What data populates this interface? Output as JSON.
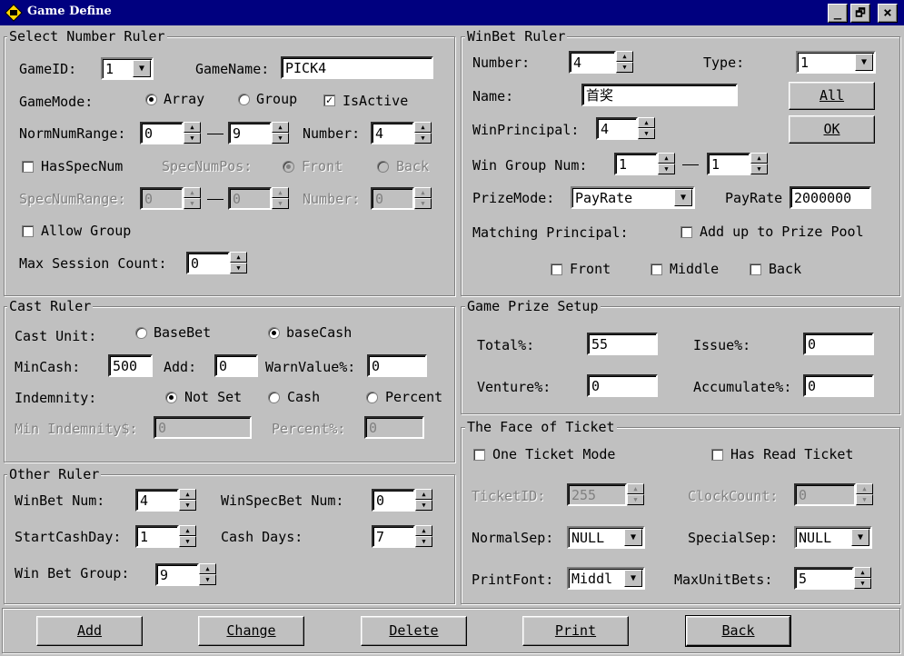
{
  "window": {
    "title": "Game Define",
    "min": "_",
    "max": "🗗",
    "close": "×"
  },
  "select": {
    "title": "Select Number Ruler",
    "gameid_label": "GameID:",
    "gameid_value": "1",
    "gamename_label": "GameName:",
    "gamename_value": "PICK4",
    "gamemode_label": "GameMode:",
    "array": "Array",
    "group": "Group",
    "isactive": "IsActive",
    "normrange_label": "NormNumRange:",
    "norm_from": "0",
    "norm_to": "9",
    "number_label": "Number:",
    "number_value": "4",
    "hasspec": "HasSpecNum",
    "specpos_label": "SpecNumPos:",
    "front": "Front",
    "back": "Back",
    "specrange_label": "SpecNumRange:",
    "spec_from": "0",
    "spec_to": "0",
    "spec_number_label": "Number:",
    "spec_number_value": "0",
    "allow_group": "Allow Group",
    "max_session_label": "Max Session Count:",
    "max_session_value": "0"
  },
  "cast": {
    "title": "Cast Ruler",
    "unit_label": "Cast Unit:",
    "basebet": "BaseBet",
    "basecash": "baseCash",
    "mincash_label": "MinCash:",
    "mincash_value": "500",
    "add_label": "Add:",
    "add_value": "0",
    "warn_label": "WarnValue%:",
    "warn_value": "0",
    "indemnity_label": "Indemnity:",
    "notset": "Not Set",
    "cash": "Cash",
    "percent": "Percent",
    "minind_label": "Min Indemnity$:",
    "minind_value": "0",
    "percent_label": "Percent%:",
    "percent_value": "0"
  },
  "other": {
    "title": "Other Ruler",
    "winbet_label": "WinBet Num:",
    "winbet_value": "4",
    "winspec_label": "WinSpecBet Num:",
    "winspec_value": "0",
    "startday_label": "StartCashDay:",
    "startday_value": "1",
    "cashdays_label": "Cash Days:",
    "cashdays_value": "7",
    "wingroup_label": "Win Bet Group:",
    "wingroup_value": "9"
  },
  "winbet": {
    "title": "WinBet Ruler",
    "number_label": "Number:",
    "number_value": "4",
    "type_label": "Type:",
    "type_value": "1",
    "name_label": "Name:",
    "name_value": "首奖",
    "all_btn": "All",
    "ok_btn": "OK",
    "principal_label": "WinPrincipal:",
    "principal_value": "4",
    "groupnum_label": "Win Group Num:",
    "group_from": "1",
    "group_to": "1",
    "prizemode_label": "PrizeMode:",
    "prizemode_value": "PayRate",
    "payrate_label": "PayRate",
    "payrate_value": "2000000",
    "matching_label": "Matching Principal:",
    "addup": "Add up to Prize Pool",
    "front": "Front",
    "middle": "Middle",
    "back": "Back"
  },
  "prize": {
    "title": "Game Prize Setup",
    "total_label": "Total%:",
    "total_value": "55",
    "issue_label": "Issue%:",
    "issue_value": "0",
    "venture_label": "Venture%:",
    "venture_value": "0",
    "accum_label": "Accumulate%:",
    "accum_value": "0"
  },
  "ticket": {
    "title": "The Face of Ticket",
    "one_ticket": "One Ticket Mode",
    "has_read": "Has Read Ticket",
    "ticketid_label": "TicketID:",
    "ticketid_value": "255",
    "clock_label": "ClockCount:",
    "clock_value": "0",
    "normalsep_label": "NormalSep:",
    "normalsep_value": "NULL",
    "specialsep_label": "SpecialSep:",
    "specialsep_value": "NULL",
    "printfont_label": "PrintFont:",
    "printfont_value": "Middl",
    "maxunit_label": "MaxUnitBets:",
    "maxunit_value": "5"
  },
  "buttons": {
    "add": "Add",
    "change": "Change",
    "delete": "Delete",
    "print": "Print",
    "back": "Back"
  },
  "glyphs": {
    "up": "▲",
    "down": "▼",
    "check": "✓",
    "dash": "—"
  }
}
